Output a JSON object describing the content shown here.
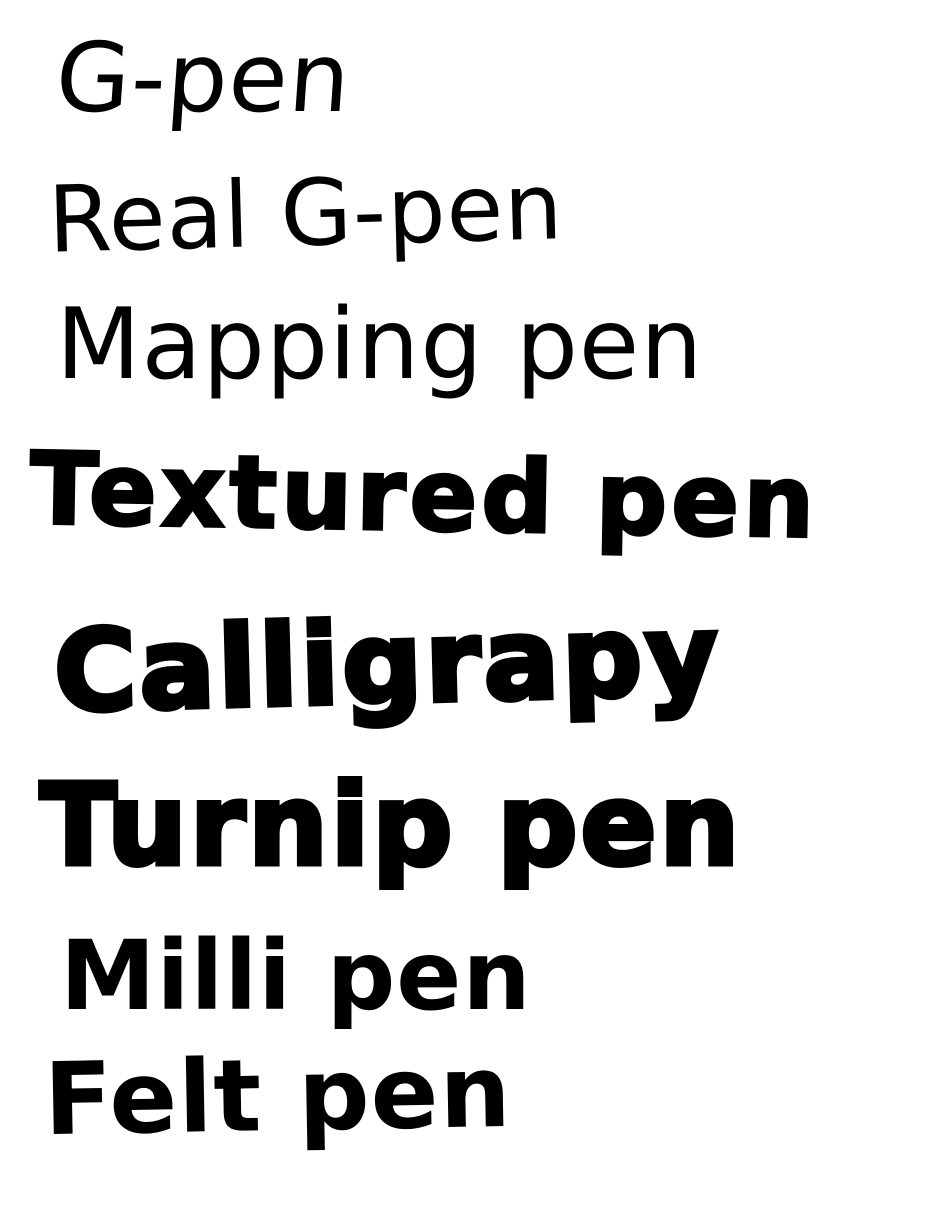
{
  "canvas": {
    "background": "#ffffff",
    "ink_color": "#000000"
  },
  "pen_samples": [
    "G-pen",
    "Real G-pen",
    "Mapping pen",
    "Textured pen",
    "Calligrapy",
    "Turnip pen",
    "Milli pen",
    "Felt pen"
  ]
}
